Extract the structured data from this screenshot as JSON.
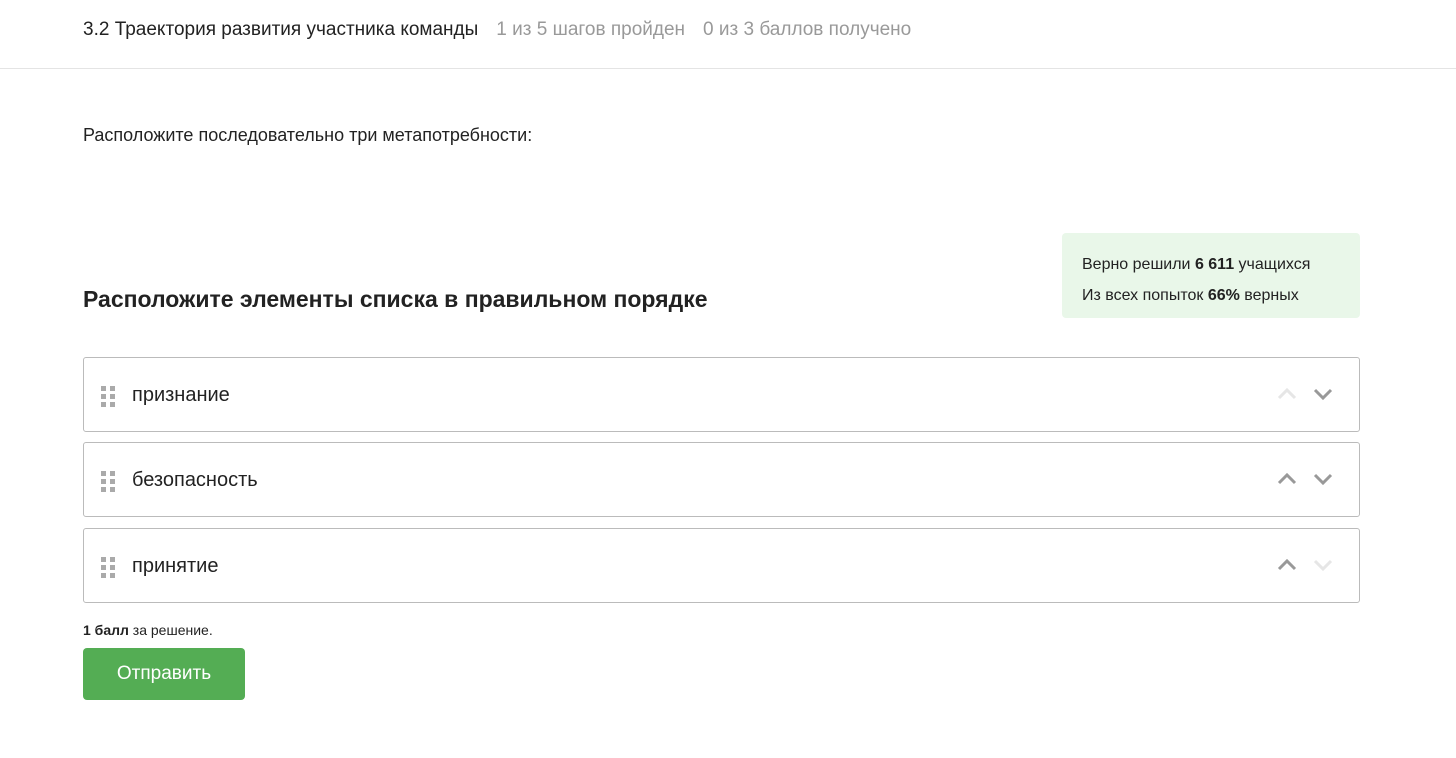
{
  "header": {
    "title": "3.2 Траектория развития участника команды",
    "steps": "1 из 5 шагов пройден",
    "points": "0 из 3 баллов  получено"
  },
  "prompt": "Расположите последовательно три метапотребности:",
  "stats": {
    "line1_pre": "Верно решили ",
    "line1_bold": "6 611",
    "line1_post": " учащихся",
    "line2_pre": "Из всех попыток ",
    "line2_bold": "66%",
    "line2_post": " верных"
  },
  "question_title": "Расположите элементы списка в правильном порядке",
  "items": [
    {
      "label": "признание",
      "up_enabled": false,
      "down_enabled": true
    },
    {
      "label": "безопасность",
      "up_enabled": true,
      "down_enabled": true
    },
    {
      "label": "принятие",
      "up_enabled": true,
      "down_enabled": false
    }
  ],
  "score": {
    "bold": "1 балл",
    "rest": " за решение."
  },
  "submit_label": "Отправить",
  "colors": {
    "accent": "#54ad54",
    "stats_bg": "#e9f7e9"
  }
}
